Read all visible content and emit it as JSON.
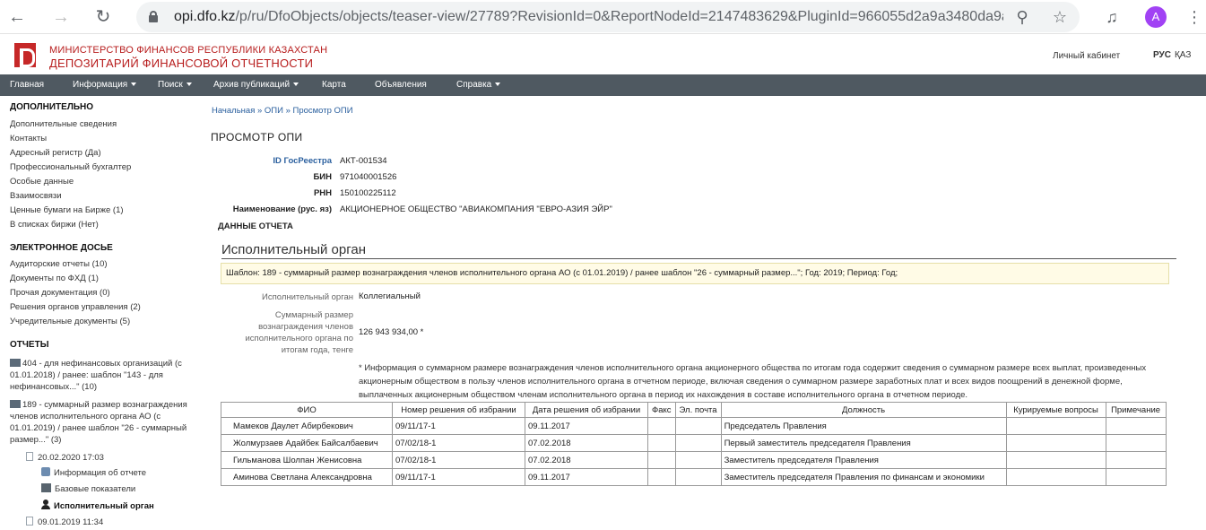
{
  "browser": {
    "url_host": "opi.dfo.kz",
    "url_rest": "/p/ru/DfoObjects/objects/teaser-view/27789?RevisionId=0&ReportNodeId=2147483629&PluginId=966055d2a9a3480da9a65b...",
    "avatar_letter": "A"
  },
  "header": {
    "org_line1": "МИНИСТЕРСТВО ФИНАНСОВ РЕСПУБЛИКИ КАЗАХСТАН",
    "org_line2": "ДЕПОЗИТАРИЙ ФИНАНСОВОЙ ОТЧЕТНОСТИ",
    "cabinet": "Личный кабинет",
    "lang_active": "РУС",
    "lang_other": "ҚАЗ"
  },
  "nav": {
    "items": [
      {
        "label": "Главная"
      },
      {
        "label": "Информация"
      },
      {
        "label": "Поиск"
      },
      {
        "label": "Архив публикаций"
      },
      {
        "label": "Карта"
      },
      {
        "label": "Объявления"
      },
      {
        "label": "Справка"
      }
    ]
  },
  "sidebar": {
    "section1_title": "ДОПОЛНИТЕЛЬНО",
    "section1_items": [
      "Дополнительные сведения",
      "Контакты",
      "Адресный регистр (Да)",
      "Профессиональный бухгалтер",
      "Особые данные",
      "Взаимосвязи",
      "Ценные бумаги на Бирже (1)",
      "В списках биржи (Нет)"
    ],
    "section2_title": "ЭЛЕКТРОННОЕ ДОСЬЕ",
    "section2_items": [
      "Аудиторские отчеты (10)",
      "Документы по ФХД (1)",
      "Прочая документация (0)",
      "Решения органов управления (2)",
      "Учредительные документы (5)"
    ],
    "section3_title": "ОТЧЕТЫ",
    "report1": "404 - для нефинансовых организаций (с 01.01.2018) / ранее: шаблон \"143 - для нефинансовых...\" (10)",
    "report2": "189 - суммарный размер вознаграждения членов исполнительного органа АО (с 01.01.2019) / ранее шаблон \"26 - суммарный размер...\" (3)",
    "tree_date1": "20.02.2020 17:03",
    "tree_info": "Информация об отчете",
    "tree_base": "Базовые показатели",
    "tree_exec": "Исполнительный орган",
    "tree_date2": "09.01.2019 11:34"
  },
  "main": {
    "breadcrumb": "Начальная » ОПИ » Просмотр ОПИ",
    "title": "ПРОСМОТР ОПИ",
    "fields": [
      {
        "label": "ID ГосРеестра",
        "value": "АКТ-001534"
      },
      {
        "label": "БИН",
        "value": "971040001526"
      },
      {
        "label": "РНН",
        "value": "150100225112"
      },
      {
        "label": "Наименование (рус. яз)",
        "value": "АКЦИОНЕРНОЕ ОБЩЕСТВО \"АВИАКОМПАНИЯ \"ЕВРО-АЗИЯ ЭЙР\""
      }
    ],
    "report_data_title": "ДАННЫЕ ОТЧЕТА",
    "exec_title": "Исполнительный орган",
    "template_line": "Шаблон: 189 - суммарный размер вознаграждения членов исполнительного органа АО (с 01.01.2019) / ранее шаблон \"26 - суммарный размер...\"; Год: 2019; Период: Год;",
    "ind1_label": "Исполнительный орган",
    "ind1_value": "Коллегиальный",
    "ind2_label": "Суммарный размер вознаграждения членов исполнительного органа по итогам года, тенге",
    "ind2_value": "126 943 934,00 *",
    "note": "* Информация о суммарном размере вознаграждения членов исполнительного органа акционерного общества по итогам года содержит сведения о суммарном размере всех выплат, произведенных акционерным обществом в пользу членов исполнительного органа в отчетном периоде, включая сведения о суммарном размере заработных плат и всех видов поощрений в денежной форме, выплаченных акционерным обществом членам исполнительного органа в период их нахождения в составе исполнительного органа в отчетном периоде.",
    "table": {
      "columns": [
        "ФИО",
        "Номер решения об избрании",
        "Дата решения об избрании",
        "Факс",
        "Эл. почта",
        "Должность",
        "Курируемые вопросы",
        "Примечание"
      ],
      "rows": [
        [
          "Мамеков Даулет Абирбекович",
          "09/11/17-1",
          "09.11.2017",
          "",
          "",
          "Председатель Правления",
          "",
          ""
        ],
        [
          "Жолмурзаев Адайбек Байсалбаевич",
          "07/02/18-1",
          "07.02.2018",
          "",
          "",
          "Первый заместитель председателя Правления",
          "",
          ""
        ],
        [
          "Гильманова Шолпан Женисовна",
          "07/02/18-1",
          "07.02.2018",
          "",
          "",
          "Заместитель председателя Правления",
          "",
          ""
        ],
        [
          "Аминова Светлана Александровна",
          "09/11/17-1",
          "09.11.2017",
          "",
          "",
          "Заместитель председателя Правления по финансам и экономики",
          "",
          ""
        ]
      ]
    }
  }
}
